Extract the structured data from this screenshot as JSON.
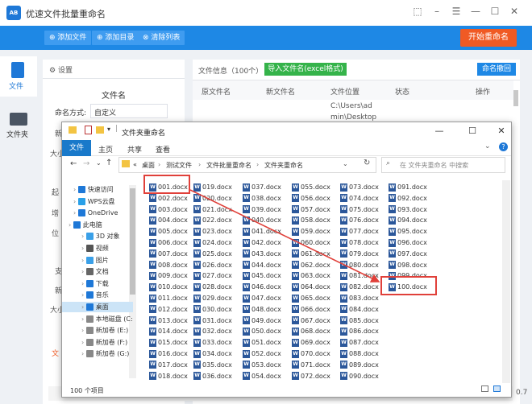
{
  "app": {
    "title": "优速文件批量重命名",
    "logo_text": "AB",
    "toolbar": {
      "add_file": "添加文件",
      "add_folder": "添加目录",
      "clear_list": "清除列表",
      "start": "开始重命名"
    },
    "side": {
      "file": "文件",
      "folder": "文件夹"
    },
    "settings": {
      "header": "设置",
      "filename_header": "文件名",
      "rename_label": "命名方式:",
      "rename_value": "自定义",
      "fragments": [
        "新",
        "大小",
        "起",
        "增",
        "位",
        "支",
        "新",
        "大小",
        "文"
      ]
    },
    "info": {
      "label": "文件信息（100个）",
      "import_btn": "导入文件名(excel格式)",
      "restore_btn": "命名撤回",
      "columns": [
        "原文件名",
        "新文件名",
        "文件位置",
        "状态",
        "操作"
      ],
      "row_location_1": "C:\\Users\\ad",
      "row_location_2": "min\\Desktop"
    },
    "status_fragment": "0.7"
  },
  "explorer": {
    "title": "文件夹重命名",
    "ribbon_tabs": [
      "文件",
      "主页",
      "共享",
      "查看"
    ],
    "breadcrumb": [
      "«",
      "桌面",
      "测试文件",
      "文件批量重命名",
      "文件夹重命名"
    ],
    "search_placeholder": "在 文件夹重命名 中搜索",
    "tree": [
      "快速访问",
      "WPS云盘",
      "OneDrive",
      "此电脑",
      "3D 对象",
      "视频",
      "图片",
      "文档",
      "下载",
      "音乐",
      "桌面",
      "本地磁盘 (C:)",
      "新加卷 (E:)",
      "新加卷 (F:)",
      "新加卷 (G:)"
    ],
    "files": [
      "001.docx",
      "002.docx",
      "003.docx",
      "004.docx",
      "005.docx",
      "006.docx",
      "007.docx",
      "008.docx",
      "009.docx",
      "010.docx",
      "011.docx",
      "012.docx",
      "013.docx",
      "014.docx",
      "015.docx",
      "016.docx",
      "017.docx",
      "018.docx",
      "019.docx",
      "020.docx",
      "021.docx",
      "022.docx",
      "023.docx",
      "024.docx",
      "025.docx",
      "026.docx",
      "027.docx",
      "028.docx",
      "029.docx",
      "030.docx",
      "031.docx",
      "032.docx",
      "033.docx",
      "034.docx",
      "035.docx",
      "036.docx",
      "037.docx",
      "038.docx",
      "039.docx",
      "040.docx",
      "041.docx",
      "042.docx",
      "043.docx",
      "044.docx",
      "045.docx",
      "046.docx",
      "047.docx",
      "048.docx",
      "049.docx",
      "050.docx",
      "051.docx",
      "052.docx",
      "053.docx",
      "054.docx",
      "055.docx",
      "056.docx",
      "057.docx",
      "058.docx",
      "059.docx",
      "060.docx",
      "061.docx",
      "062.docx",
      "063.docx",
      "064.docx",
      "065.docx",
      "066.docx",
      "067.docx",
      "068.docx",
      "069.docx",
      "070.docx",
      "071.docx",
      "072.docx",
      "073.docx",
      "074.docx",
      "075.docx",
      "076.docx",
      "077.docx",
      "078.docx",
      "079.docx",
      "080.docx",
      "081.docx",
      "082.docx",
      "083.docx",
      "084.docx",
      "085.docx",
      "086.docx",
      "087.docx",
      "088.docx",
      "089.docx",
      "090.docx",
      "091.docx",
      "092.docx",
      "093.docx",
      "094.docx",
      "095.docx",
      "096.docx",
      "097.docx",
      "098.docx",
      "099.docx",
      "100.docx"
    ],
    "status": "100 个项目"
  }
}
